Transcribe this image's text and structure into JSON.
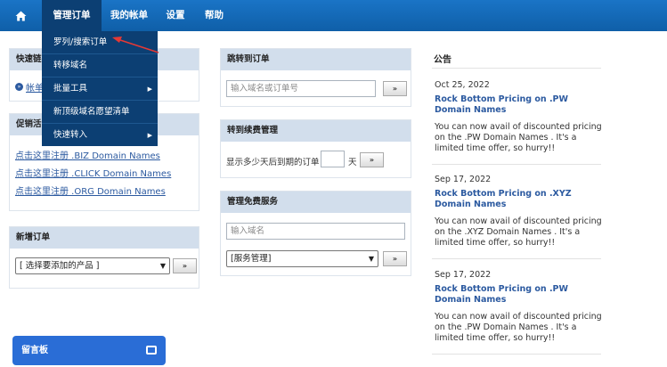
{
  "nav": {
    "home_icon": "home-icon",
    "items": [
      "管理订单",
      "我的帐单",
      "设置",
      "帮助"
    ]
  },
  "dropdown": {
    "items": [
      "罗列/搜索订单",
      "转移域名",
      "批量工具",
      "新顶级域名愿望清单",
      "快速转入"
    ]
  },
  "quick_links": {
    "title": "快速链",
    "link": "帐单"
  },
  "promo": {
    "title": "促销活",
    "links": [
      "点击这里注册 .BIZ Domain Names",
      "点击这里注册 .CLICK Domain Names",
      "点击这里注册 .ORG Domain Names"
    ]
  },
  "new_order": {
    "title": "新增订单",
    "select": "[ 选择要添加的产品 ]",
    "go": "»"
  },
  "jump_order": {
    "title": "跳转到订单",
    "placeholder": "输入域名或订单号",
    "go": "»"
  },
  "renewal": {
    "title": "转到续费管理",
    "label_before": "显示多少天后到期的订单",
    "label_after": "天",
    "go": "»"
  },
  "free_services": {
    "title": "管理免费服务",
    "placeholder": "输入域名",
    "select": "[服务管理]",
    "go": "»"
  },
  "announcements": {
    "title": "公告",
    "items": [
      {
        "date": "Oct 25, 2022",
        "headline": "Rock Bottom Pricing on .PW Domain Names",
        "body": "You can now avail of discounted pricing on the .PW Domain Names . It's a limited time offer, so hurry!!"
      },
      {
        "date": "Sep 17, 2022",
        "headline": "Rock Bottom Pricing on .XYZ Domain Names",
        "body": "You can now avail of discounted pricing on the .XYZ Domain Names . It's a limited time offer, so hurry!!"
      },
      {
        "date": "Sep 17, 2022",
        "headline": "Rock Bottom Pricing on .PW Domain Names",
        "body": "You can now avail of discounted pricing on the .PW Domain Names . It's a limited time offer, so hurry!!"
      }
    ]
  },
  "chat": {
    "label": "留言板"
  },
  "colors": {
    "nav_bg": "#1a74c6",
    "dropdown_bg": "#0c3f73",
    "panel_head": "#d2deec",
    "link": "#2c5aa0",
    "arrow": "#e53935",
    "chat_bg": "#2a6dd6"
  }
}
